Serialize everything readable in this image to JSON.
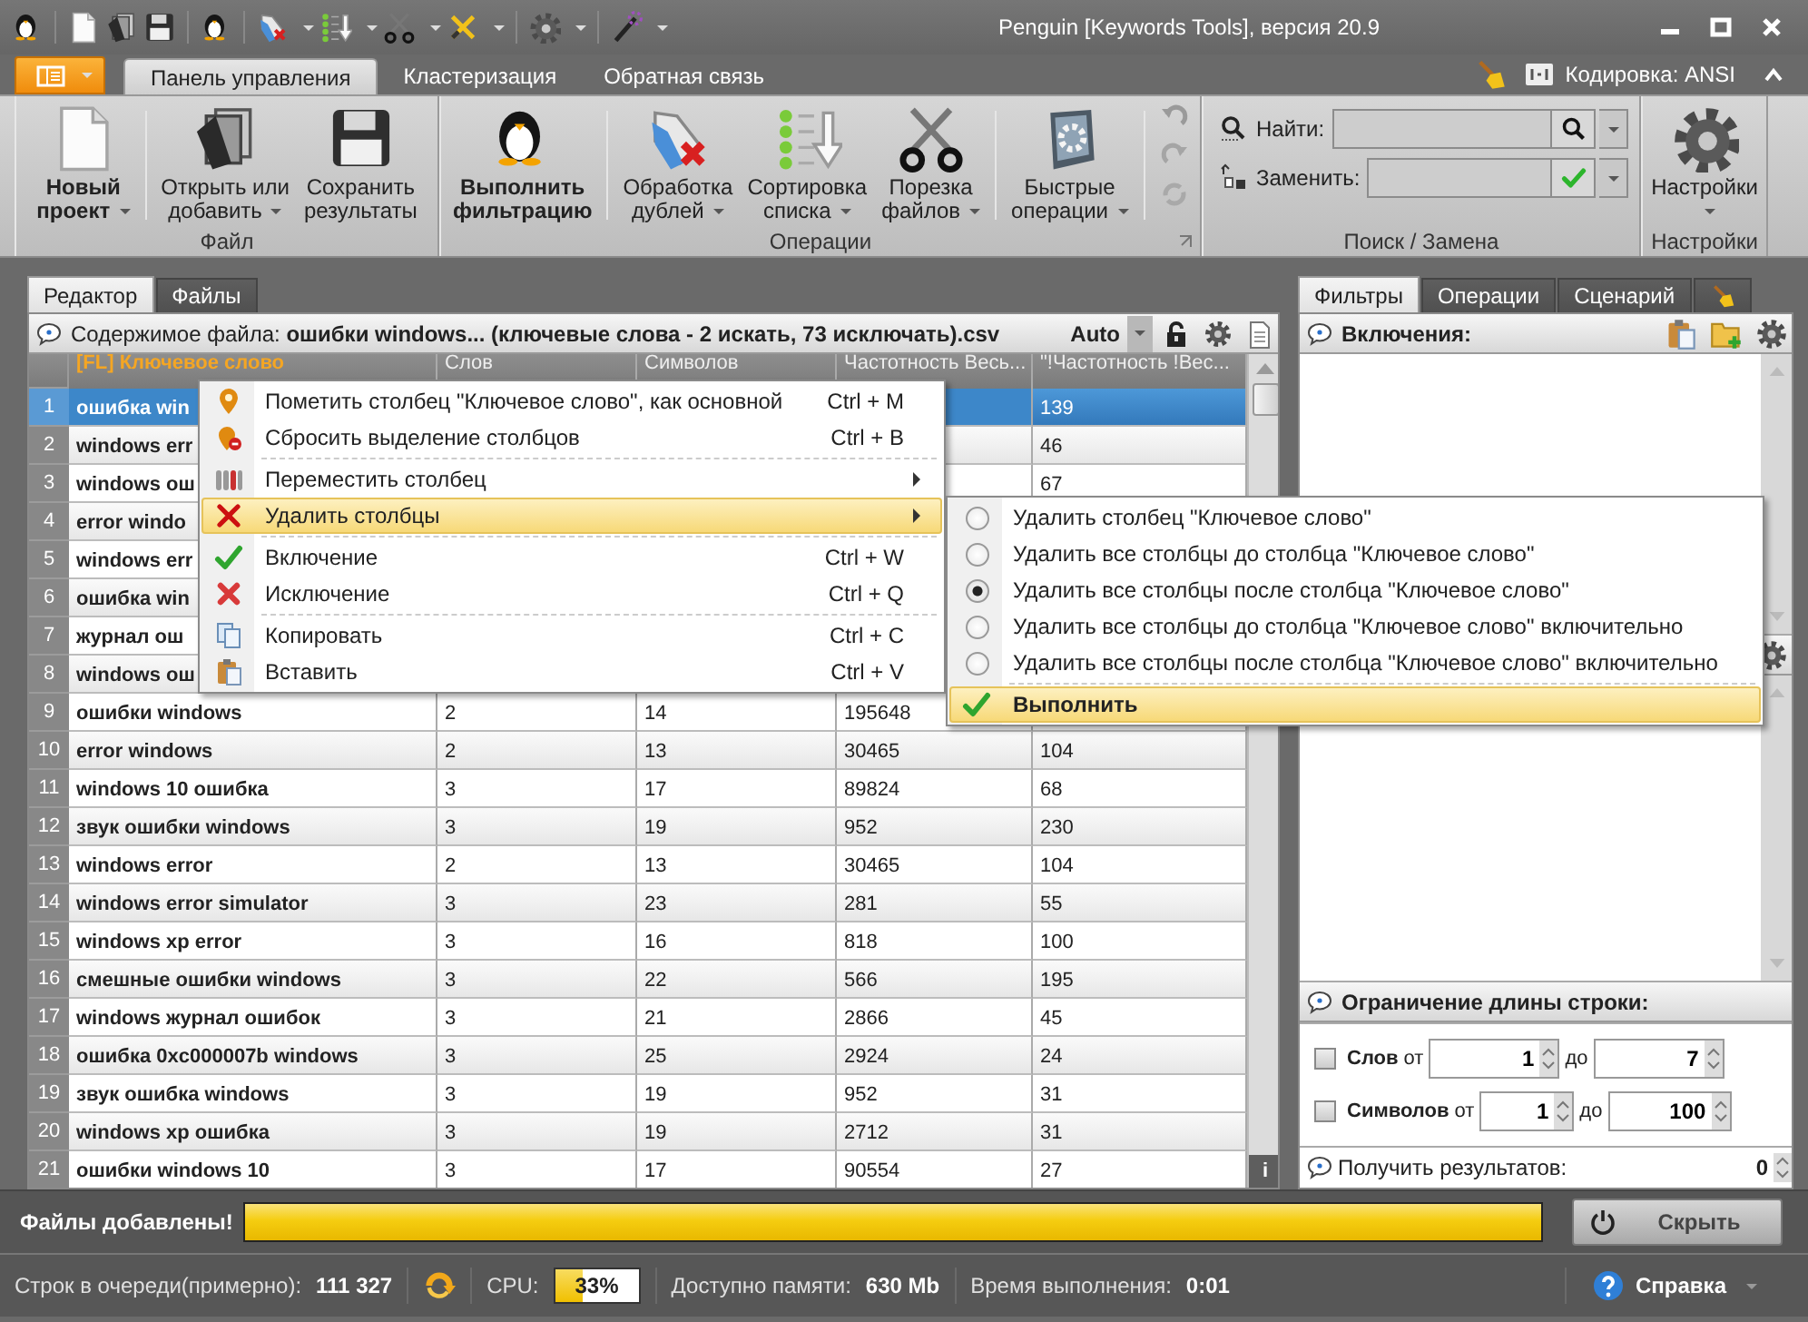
{
  "window": {
    "title": "Penguin [Keywords Tools], версия 20.9"
  },
  "ribbon": {
    "tabs": [
      {
        "label": "Панель управления",
        "selected": true
      },
      {
        "label": "Кластеризация",
        "selected": false
      },
      {
        "label": "Обратная связь",
        "selected": false
      }
    ],
    "encoding": "Кодировка: ANSI",
    "groups": [
      {
        "label": "Файл",
        "buttons": [
          {
            "label": "Новый\nпроект",
            "bold": true,
            "dropdown": true
          },
          {
            "label": "Открыть или\nдобавить",
            "bold": false,
            "dropdown": true
          },
          {
            "label": "Сохранить\nрезультаты",
            "bold": false,
            "dropdown": false
          }
        ]
      },
      {
        "label": "Операции",
        "buttons": [
          {
            "label": "Выполнить\nфильтрацию",
            "bold": true,
            "dropdown": false
          },
          {
            "label": "Обработка\nдублей",
            "bold": false,
            "dropdown": true
          },
          {
            "label": "Сортировка\nсписка",
            "bold": false,
            "dropdown": true
          },
          {
            "label": "Порезка\nфайлов",
            "bold": false,
            "dropdown": true
          },
          {
            "label": "Быстрые\nоперации",
            "bold": false,
            "dropdown": true
          }
        ]
      },
      {
        "label": "Поиск / Замена",
        "fields": [
          {
            "kind": "find",
            "label": "Найти:"
          },
          {
            "kind": "replace",
            "label": "Заменить:"
          }
        ]
      },
      {
        "label": "Настройки",
        "buttons": [
          {
            "label": "Настройки",
            "bold": false,
            "dropdown": true
          }
        ]
      }
    ]
  },
  "editor": {
    "tabs": [
      {
        "label": "Редактор",
        "selected": true
      },
      {
        "label": "Файлы",
        "selected": false
      }
    ],
    "file_info": "Содержимое файла: **ошибки windows... (ключевые слова - 2 искать, 73 исключать).csv**",
    "mode": "Auto",
    "info_button": "i",
    "columns": [
      {
        "label": "[FL] Ключевое слово",
        "main": true
      },
      {
        "label": "Слов",
        "main": false
      },
      {
        "label": "Символов",
        "main": false
      },
      {
        "label": "Частотность Весь...",
        "main": false
      },
      {
        "label": "\"!Частотность !Вес...",
        "main": false
      }
    ],
    "rows": [
      {
        "number": "1",
        "selected": true,
        "keyword": "ошибка win",
        "frequency_exact": "139"
      },
      {
        "number": "2",
        "selected": false,
        "keyword": "windows err",
        "frequency_exact": "46"
      },
      {
        "number": "3",
        "selected": false,
        "keyword": "windows ош",
        "frequency_exact": "67"
      },
      {
        "number": "4",
        "selected": false,
        "keyword": "error windo"
      },
      {
        "number": "5",
        "selected": false,
        "keyword": "windows err"
      },
      {
        "number": "6",
        "selected": false,
        "keyword": "ошибка win"
      },
      {
        "number": "7",
        "selected": false,
        "keyword": "журнал ош"
      },
      {
        "number": "8",
        "selected": false,
        "keyword": "windows ош"
      },
      {
        "number": "9",
        "selected": false,
        "keyword": "ошибки windows",
        "words": "2",
        "symbols": "14",
        "frequency": "195648"
      },
      {
        "number": "10",
        "selected": false,
        "keyword": "error windows",
        "words": "2",
        "symbols": "13",
        "frequency": "30465",
        "frequency_exact": "104"
      },
      {
        "number": "11",
        "selected": false,
        "keyword": "windows 10 ошибка",
        "words": "3",
        "symbols": "17",
        "frequency": "89824",
        "frequency_exact": "68"
      },
      {
        "number": "12",
        "selected": false,
        "keyword": "звук ошибки windows",
        "words": "3",
        "symbols": "19",
        "frequency": "952",
        "frequency_exact": "230"
      },
      {
        "number": "13",
        "selected": false,
        "keyword": "windows error",
        "words": "2",
        "symbols": "13",
        "frequency": "30465",
        "frequency_exact": "104"
      },
      {
        "number": "14",
        "selected": false,
        "keyword": "windows error simulator",
        "words": "3",
        "symbols": "23",
        "frequency": "281",
        "frequency_exact": "55"
      },
      {
        "number": "15",
        "selected": false,
        "keyword": "windows xp error",
        "words": "3",
        "symbols": "16",
        "frequency": "818",
        "frequency_exact": "100"
      },
      {
        "number": "16",
        "selected": false,
        "keyword": "смешные ошибки windows",
        "words": "3",
        "symbols": "22",
        "frequency": "566",
        "frequency_exact": "195"
      },
      {
        "number": "17",
        "selected": false,
        "keyword": "windows журнал ошибок",
        "words": "3",
        "symbols": "21",
        "frequency": "2866",
        "frequency_exact": "45"
      },
      {
        "number": "18",
        "selected": false,
        "keyword": "ошибка 0xc000007b windows",
        "words": "3",
        "symbols": "25",
        "frequency": "2924",
        "frequency_exact": "24"
      },
      {
        "number": "19",
        "selected": false,
        "keyword": "звук ошибка windows",
        "words": "3",
        "symbols": "19",
        "frequency": "952",
        "frequency_exact": "31"
      },
      {
        "number": "20",
        "selected": false,
        "keyword": "windows xp ошибка",
        "words": "3",
        "symbols": "19",
        "frequency": "2712",
        "frequency_exact": "31"
      },
      {
        "number": "21",
        "selected": false,
        "keyword": "ошибки windows 10",
        "words": "3",
        "symbols": "17",
        "frequency": "90554",
        "frequency_exact": "27"
      }
    ]
  },
  "context_menu": {
    "items": [
      {
        "kind": "item",
        "label": "Пометить столбец \"Ключевое слово\", как основной",
        "shortcut": "Ctrl + M",
        "highlighted": false
      },
      {
        "kind": "item",
        "label": "Сбросить выделение столбцов",
        "shortcut": "Ctrl + B",
        "highlighted": false
      },
      {
        "kind": "separator"
      },
      {
        "kind": "submenu",
        "label": "Переместить столбец",
        "highlighted": false
      },
      {
        "kind": "submenu",
        "label": "Удалить столбцы",
        "highlighted": true
      },
      {
        "kind": "separator"
      },
      {
        "kind": "item",
        "label": "Включение",
        "shortcut": "Ctrl + W",
        "highlighted": false
      },
      {
        "kind": "item",
        "label": "Исключение",
        "shortcut": "Ctrl + Q",
        "highlighted": false
      },
      {
        "kind": "separator"
      },
      {
        "kind": "item",
        "label": "Копировать",
        "shortcut": "Ctrl + C",
        "highlighted": false
      },
      {
        "kind": "item",
        "label": "Вставить",
        "shortcut": "Ctrl + V",
        "highlighted": false
      }
    ]
  },
  "submenu": {
    "items": [
      {
        "kind": "radio",
        "label": "Удалить столбец \"Ключевое слово\"",
        "selected": false
      },
      {
        "kind": "radio",
        "label": "Удалить все столбцы до столбца \"Ключевое слово\"",
        "selected": false
      },
      {
        "kind": "radio",
        "label": "Удалить все столбцы после столбца \"Ключевое слово\"",
        "selected": true
      },
      {
        "kind": "radio",
        "label": "Удалить все столбцы до столбца \"Ключевое слово\" включительно",
        "selected": false
      },
      {
        "kind": "radio",
        "label": "Удалить все столбцы после столбца \"Ключевое слово\" включительно",
        "selected": false
      },
      {
        "kind": "separator"
      },
      {
        "kind": "action",
        "label": "Выполнить",
        "highlighted": true
      }
    ]
  },
  "filters": {
    "tabs": [
      {
        "label": "Фильтры",
        "selected": true
      },
      {
        "label": "Операции",
        "selected": false
      },
      {
        "label": "Сценарий",
        "selected": false
      }
    ],
    "inclusions_title": "Включения:",
    "length_limit": {
      "title": "Ограничение длины строки:",
      "rows": [
        {
          "label": "Слов",
          "checked": false,
          "from_label": "от",
          "from": "1",
          "to_label": "до",
          "to": "7"
        },
        {
          "label": "Символов",
          "checked": false,
          "from_label": "от",
          "from": "1",
          "to_label": "до",
          "to": "100"
        }
      ]
    },
    "results_label": "Получить результатов:",
    "results_value": "0"
  },
  "progress": {
    "label": "Файлы добавлены!",
    "level": 1,
    "button": "Скрыть"
  },
  "status_bar": {
    "queue_label": "Строк в очереди(примерно):",
    "queue_value": "111 327",
    "cpu_label": "CPU:",
    "cpu": {
      "level": 0.33,
      "reading": "33%"
    },
    "memory_label": "Доступно памяти:",
    "memory_value": "630 Mb",
    "time_label": "Время выполнения:",
    "time_value": "0:01",
    "help": "Справка"
  }
}
